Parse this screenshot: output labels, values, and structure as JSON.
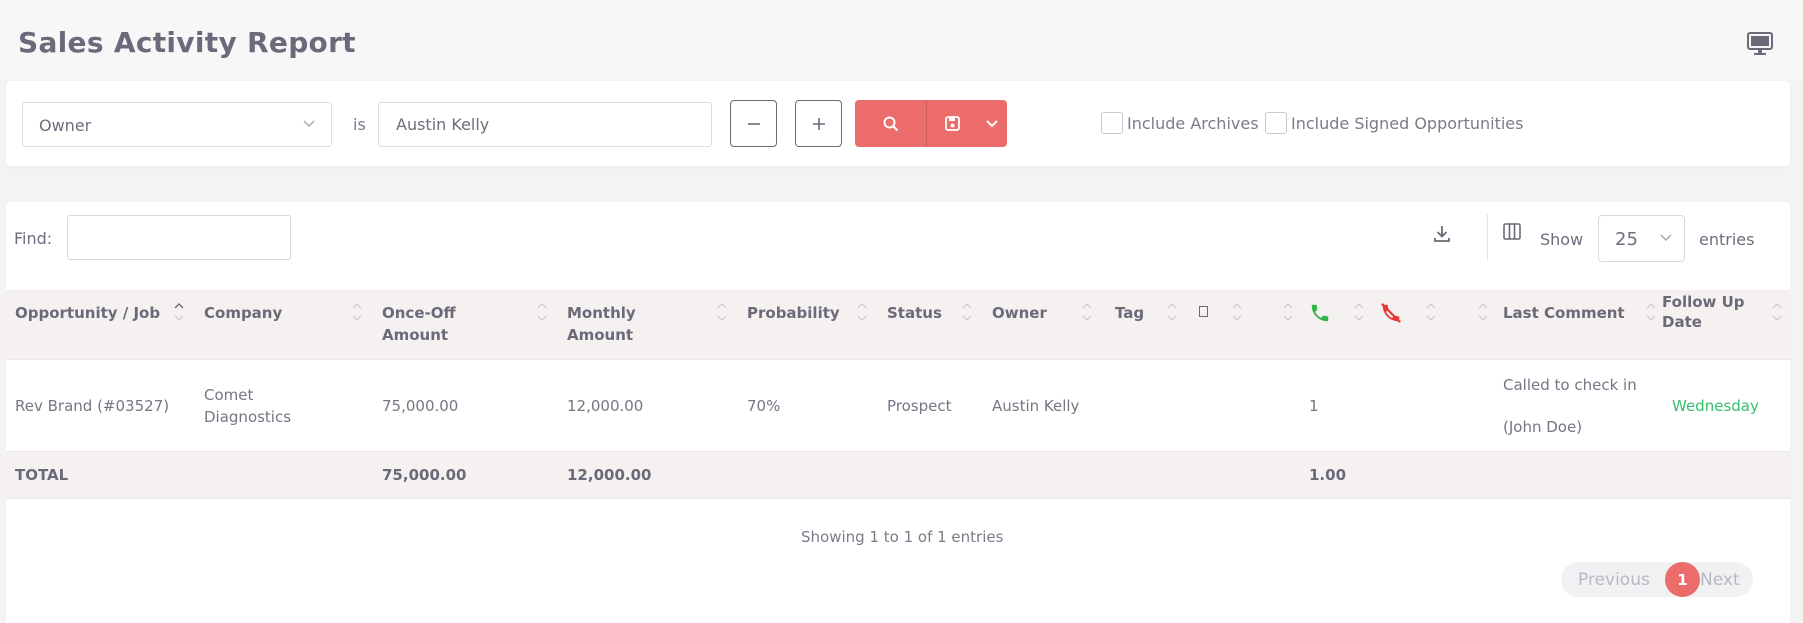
{
  "page": {
    "title": "Sales Activity Report"
  },
  "filter": {
    "field": "Owner",
    "operator": "is",
    "value": "Austin Kelly",
    "include_archives": "Include Archives",
    "include_signed": "Include Signed Opportunities"
  },
  "toolbar": {
    "find_label": "Find:",
    "find_value": "",
    "show_label": "Show",
    "page_length": "25",
    "entries_label": "entries"
  },
  "table": {
    "headers": {
      "opportunity": "Opportunity / Job",
      "company": "Company",
      "once_off_1": "Once-Off",
      "once_off_2": "Amount",
      "monthly_1": "Monthly",
      "monthly_2": "Amount",
      "probability": "Probability",
      "status": "Status",
      "owner": "Owner",
      "tag": "Tag",
      "last_comment": "Last Comment",
      "follow_up_1": "Follow Up",
      "follow_up_2": "Date"
    },
    "rows": [
      {
        "opportunity": "Rev Brand (#03527)",
        "company_1": "Comet",
        "company_2": "Diagnostics",
        "once_off": "75,000.00",
        "monthly": "12,000.00",
        "probability": "70%",
        "status": "Prospect",
        "owner": "Austin Kelly",
        "calls": "1",
        "comment_1": "Called to check in",
        "comment_2": "(John Doe)",
        "follow_up": "Wednesday"
      }
    ],
    "totals": {
      "label": "TOTAL",
      "once_off": "75,000.00",
      "monthly": "12,000.00",
      "calls": "1.00"
    }
  },
  "footer": {
    "info": "Showing 1 to 1 of 1 entries",
    "previous": "Previous",
    "current_page": "1",
    "next": "Next"
  },
  "colors": {
    "accent": "#ec6c6c",
    "call_answered": "#2fb54a",
    "call_missed": "#e53935",
    "follow_up": "#35c06a"
  }
}
